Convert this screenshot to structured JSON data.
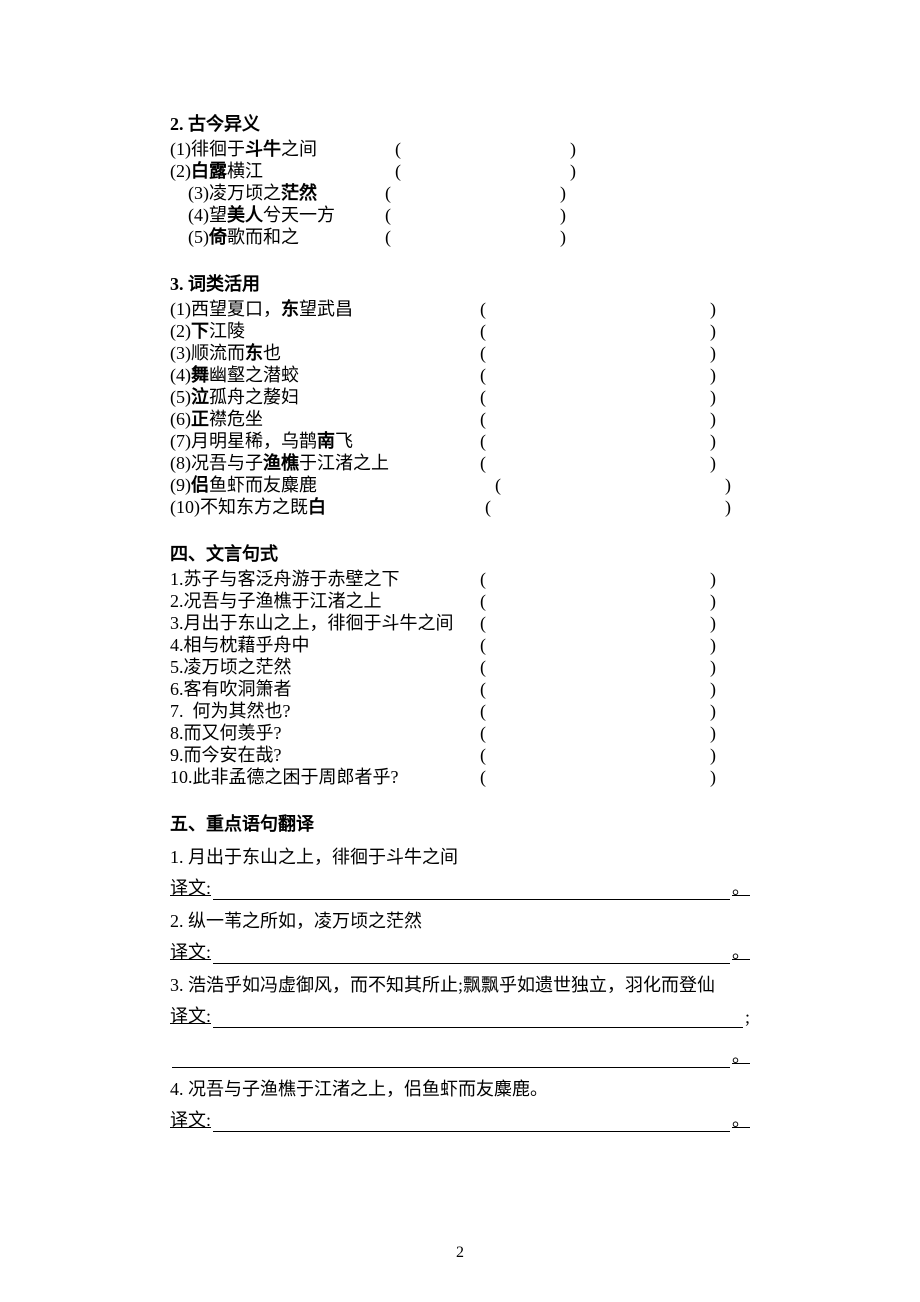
{
  "section2": {
    "title": "2.  古今异义",
    "items": [
      {
        "text_a": "(1)徘徊于",
        "bold": "斗牛",
        "text_b": "之间",
        "indent": 0,
        "open_at": 45,
        "close_at": 80
      },
      {
        "text_a": "(2)",
        "bold": "白露",
        "text_b": "横江",
        "indent": 0,
        "open_at": 45,
        "close_at": 80
      },
      {
        "text_a": "(3)凌万顷之",
        "bold": "茫然",
        "text_b": "",
        "indent": 1,
        "open_at": 43,
        "close_at": 78
      },
      {
        "text_a": "(4)望",
        "bold": "美人",
        "text_b": "兮天一方",
        "indent": 1,
        "open_at": 43,
        "close_at": 78
      },
      {
        "text_a": "(5)",
        "bold": "倚",
        "text_b": "歌而和之",
        "indent": 1,
        "open_at": 43,
        "close_at": 78
      }
    ]
  },
  "section3": {
    "title": "3.  词类活用",
    "items": [
      {
        "text_a": "(1)西望夏口，",
        "bold": "东",
        "text_b": "望武昌",
        "open_at": 62,
        "close_at": 108
      },
      {
        "text_a": "(2)",
        "bold": "下",
        "text_b": "江陵",
        "open_at": 62,
        "close_at": 108
      },
      {
        "text_a": "(3)顺流而",
        "bold": "东",
        "text_b": "也",
        "open_at": 62,
        "close_at": 108
      },
      {
        "text_a": "(4)",
        "bold": "舞",
        "text_b": "幽壑之潜蛟",
        "open_at": 62,
        "close_at": 108
      },
      {
        "text_a": "(5)",
        "bold": "泣",
        "text_b": "孤舟之嫠妇",
        "open_at": 62,
        "close_at": 108
      },
      {
        "text_a": "(6)",
        "bold": "正",
        "text_b": "襟危坐",
        "open_at": 62,
        "close_at": 108
      },
      {
        "text_a": "(7)月明星稀，乌鹊",
        "bold": "南",
        "text_b": "飞",
        "open_at": 62,
        "close_at": 108
      },
      {
        "text_a": "(8)况吾与子",
        "bold": "渔樵",
        "text_b": "于江渚之上",
        "open_at": 62,
        "close_at": 108
      },
      {
        "text_a": "(9)",
        "bold": "侣",
        "text_b": "鱼虾而友麋鹿",
        "open_at": 65,
        "close_at": 111
      },
      {
        "text_a": "(10)不知东方之既",
        "bold": "白",
        "text_b": "",
        "open_at": 63,
        "close_at": 111
      }
    ]
  },
  "section4": {
    "title": "四、文言句式",
    "items": [
      {
        "text": "1.苏子与客泛舟游于赤壁之下",
        "open_at": 62,
        "close_at": 108
      },
      {
        "text": "2.况吾与子渔樵于江渚之上",
        "open_at": 62,
        "close_at": 108
      },
      {
        "text": "3.月出于东山之上，徘徊于斗牛之间",
        "open_at": 62,
        "close_at": 108
      },
      {
        "text": "4.相与枕藉乎舟中",
        "open_at": 62,
        "close_at": 108
      },
      {
        "text": "5.凌万顷之茫然",
        "open_at": 62,
        "close_at": 108
      },
      {
        "text": "6.客有吹洞箫者",
        "open_at": 62,
        "close_at": 108
      },
      {
        "text": "7.  何为其然也?",
        "open_at": 62,
        "close_at": 108
      },
      {
        "text": "8.而又何羡乎?",
        "open_at": 62,
        "close_at": 108
      },
      {
        "text": "9.而今安在哉?",
        "open_at": 62,
        "close_at": 108
      },
      {
        "text": "10.此非孟德之困于周郎者乎?",
        "open_at": 62,
        "close_at": 108
      }
    ]
  },
  "section5": {
    "title": "五、重点语句翻译",
    "prefix": "译文:",
    "items": [
      {
        "q": "1.  月出于东山之上，徘徊于斗牛之间",
        "end": "。",
        "extra": 0
      },
      {
        "q": "2.  纵一苇之所如，凌万顷之茫然",
        "end": "。",
        "extra": 0
      },
      {
        "q": "3.  浩浩乎如冯虚御风，而不知其所止;飘飘乎如遗世独立，羽化而登仙",
        "end": ";",
        "extra": 1,
        "extra_end": "。"
      },
      {
        "q": "4.  况吾与子渔樵于江渚之上，侣鱼虾而友麋鹿。",
        "end": "。",
        "extra": 0
      }
    ]
  },
  "page_number": "2"
}
